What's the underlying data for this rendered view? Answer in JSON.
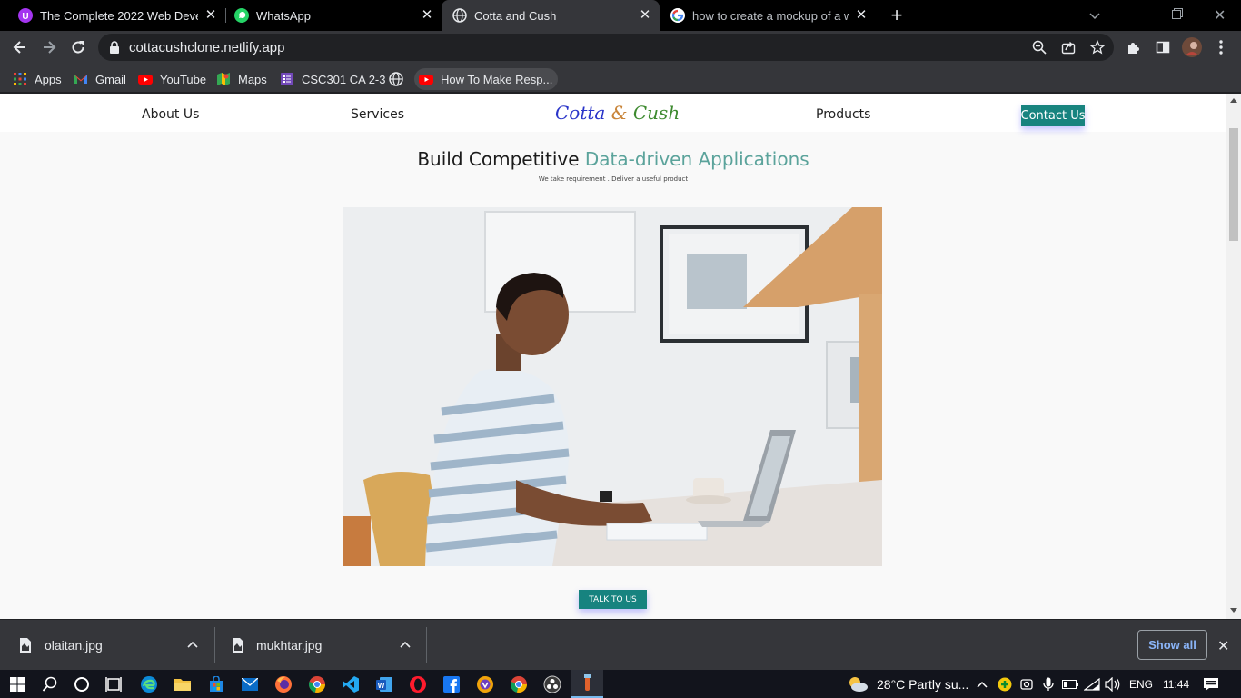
{
  "browser": {
    "tabs": [
      {
        "title": "The Complete 2022 Web Develop",
        "icon": "udemy-icon",
        "active": false
      },
      {
        "title": "WhatsApp",
        "icon": "whatsapp-icon",
        "active": false
      },
      {
        "title": "Cotta and Cush",
        "icon": "globe-icon",
        "active": true
      },
      {
        "title": "how to create a mockup of a web",
        "icon": "google-icon",
        "active": false
      }
    ],
    "url": "cottacushclone.netlify.app",
    "bookmarks": [
      {
        "label": "Apps",
        "icon": "apps-grid-icon"
      },
      {
        "label": "Gmail",
        "icon": "gmail-icon"
      },
      {
        "label": "YouTube",
        "icon": "youtube-icon"
      },
      {
        "label": "Maps",
        "icon": "maps-icon"
      },
      {
        "label": "CSC301 CA 2-3",
        "icon": "form-icon"
      },
      {
        "label": "",
        "icon": "globe-icon"
      },
      {
        "label": "How To Make Resp...",
        "icon": "youtube-icon"
      }
    ]
  },
  "site": {
    "nav": {
      "about": "About Us",
      "services": "Services",
      "logo_part1": "Cotta",
      "logo_amp": "&",
      "logo_part2": "Cush",
      "products": "Products",
      "contact": "Contact Us"
    },
    "hero": {
      "title_part1": "Build Competitive",
      "title_part2": "Data-driven Applications",
      "subtitle": "We take requirement . Deliver a useful product",
      "cta": "TALK TO US"
    },
    "colors": {
      "accent": "#17837f",
      "title_accent": "#5ba39b",
      "logo_blue": "#2a35c9",
      "logo_amp": "#c9853a",
      "logo_green": "#3d8a2f"
    }
  },
  "downloads": {
    "items": [
      {
        "name": "olaitan.jpg"
      },
      {
        "name": "mukhtar.jpg"
      }
    ],
    "show_all": "Show all"
  },
  "taskbar": {
    "weather": "28°C  Partly su...",
    "language": "ENG",
    "time": "11:44"
  }
}
